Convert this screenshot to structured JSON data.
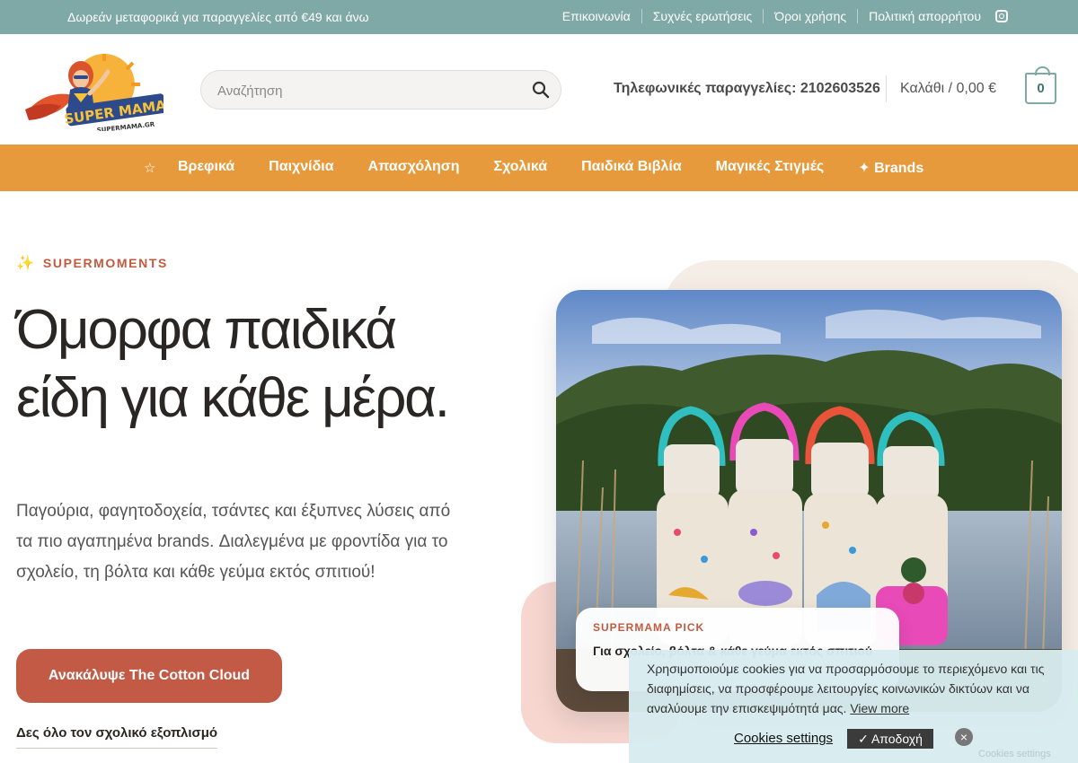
{
  "topbar": {
    "promo": "Δωρεάν μεταφορικά για παραγγελίες από €49 και άνω",
    "links": [
      "Επικοινωνία",
      "Συχνές ερωτήσεις",
      "Όροι χρήσης",
      "Πολιτική απορρήτου"
    ],
    "social_icon": "instagram-icon"
  },
  "header": {
    "logo_text": "SUPER MAMA",
    "logo_subtext": "SUPERMAMA.GR",
    "search_placeholder": "Αναζήτηση",
    "phone": "Τηλεφωνικές παραγγελίες: 2102603526",
    "cart_label": "Καλάθι / 0,00 €",
    "cart_count": "0"
  },
  "nav": {
    "star": "☆",
    "items": [
      "Βρεφικά",
      "Παιχνίδια",
      "Απασχόληση",
      "Σχολικά",
      "Παιδικά Βιβλία",
      "Μαγικές Στιγμές",
      "✦ Brands"
    ]
  },
  "hero": {
    "eyebrow_icon": "✨",
    "eyebrow": "SUPERMOMENTS",
    "headline": "Όμορφα παιδικά είδη για κάθε μέρα.",
    "lede": "Παγούρια, φαγητοδοχεία, τσάντες και έξυπνες λύσεις από τα πιο αγαπημένα brands. Διαλεγμένα με φροντίδα για το σχολείο, τη βόλτα και κάθε γεύμα εκτός σπιτιού!",
    "cta": "Ανακάλυψε The Cotton Cloud",
    "subcta": "Δες όλο τον σχολικό εξοπλισμό"
  },
  "pick": {
    "tag": "SUPERMAMA PICK",
    "title": "Για σχολείο, βόλτα & κάθε γεύμα εκτός σπιτιού"
  },
  "cookie": {
    "message": "Χρησιμοποιούμε cookies για να προσαρμόσουμε το περιεχόμενο και τις διαφημίσεις, να προσφέρουμε λειτουργίες κοινωνικών δικτύων και να αναλύουμε την επισκεψιμότητά μας.",
    "more": "View more",
    "settings": "Cookies settings",
    "accept": "✓ Αποδοχή",
    "close": "×",
    "mini": "Cookies settings"
  },
  "colors": {
    "topbar": "#7fa9a6",
    "nav": "#e69a3c",
    "accent": "#c25a40",
    "cta": "#c25a46"
  }
}
